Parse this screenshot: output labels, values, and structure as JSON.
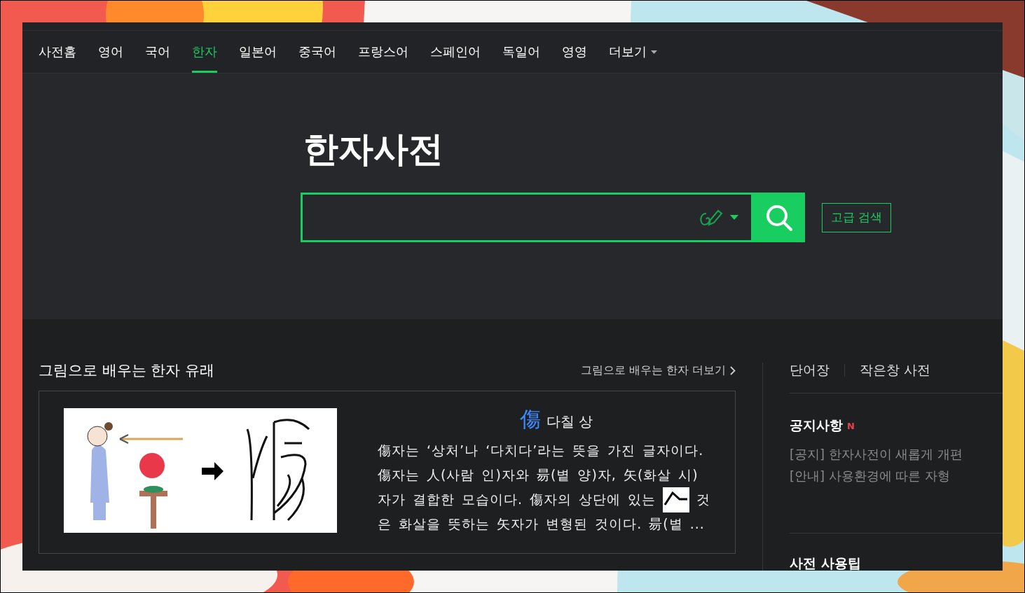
{
  "nav": {
    "tabs": [
      {
        "label": "사전홈",
        "selected": false,
        "kind": "link"
      },
      {
        "label": "영어",
        "selected": false,
        "kind": "link"
      },
      {
        "label": "국어",
        "selected": false,
        "kind": "link"
      },
      {
        "label": "한자",
        "selected": true,
        "kind": "link"
      },
      {
        "label": "일본어",
        "selected": false,
        "kind": "link"
      },
      {
        "label": "중국어",
        "selected": false,
        "kind": "link"
      },
      {
        "label": "프랑스어",
        "selected": false,
        "kind": "link"
      },
      {
        "label": "스페인어",
        "selected": false,
        "kind": "link"
      },
      {
        "label": "독일어",
        "selected": false,
        "kind": "link"
      },
      {
        "label": "영영",
        "selected": false,
        "kind": "link"
      },
      {
        "label": "더보기",
        "selected": false,
        "kind": "menu"
      }
    ]
  },
  "hero": {
    "title": "한자사전",
    "advanced_search": "고급 검색"
  },
  "origin": {
    "title": "그림으로 배우는 한자 유래",
    "more_link": "그림으로 배우는 한자 더보기",
    "card": {
      "picture": {
        "kind": "picture"
      },
      "hanja": "傷",
      "meaning": "다칠 상",
      "description": [
        [
          "傷자는 ‘상처’나 ‘다치다’라는 뜻을 가진 글자이다."
        ],
        [
          "傷자는 人(사람 인)자와 昜(볕 양)자, 矢(화살 시)"
        ],
        [
          "자가 결합한 모습이다. 傷자의 상단에 있는",
          "것"
        ],
        [
          "은 화살을 뜻하는 矢자가 변형된 것이다. 昜(볕 ..."
        ]
      ]
    }
  },
  "side": {
    "links": [
      "단어장",
      "작은창 사전"
    ],
    "notice": {
      "title": "공지사항",
      "badge": "N",
      "items": [
        "[공지] 한자사전이 새롭게 개편",
        "[안내] 사용환경에 따른 자형"
      ]
    },
    "next_title": "사전 사용팁"
  }
}
